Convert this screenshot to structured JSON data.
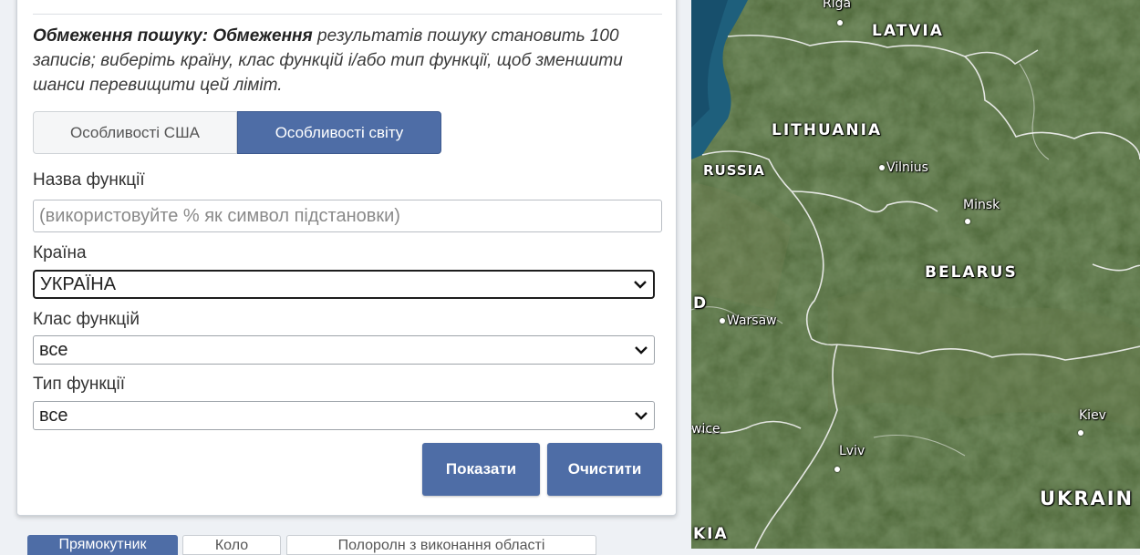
{
  "search": {
    "limit_bold": "Обмеження пошуку: Обмеження",
    "limit_text": " результатів пошуку становить 100 записів; виберіть країну, клас функцій і/або тип функції, щоб зменшити шанси перевищити цей ліміт.",
    "tabs": [
      {
        "label": "Особливості США",
        "active": false
      },
      {
        "label": "Особливості світу",
        "active": true
      }
    ],
    "feature_name_label": "Назва функції",
    "feature_name_placeholder": "(використовуйте % як символ підстановки)",
    "country_label": "Країна",
    "country_value": "УКРАЇНА",
    "feature_class_label": "Клас функцій",
    "feature_class_value": "все",
    "feature_type_label": "Тип функції",
    "feature_type_value": "все",
    "show_button": "Показати",
    "clear_button": "Очистити"
  },
  "bottom_tabs": [
    {
      "label": "Прямокутник",
      "active": true
    },
    {
      "label": "Коло",
      "active": false
    },
    {
      "label": "Полоролн з виконання області",
      "active": false
    }
  ],
  "map": {
    "countries": [
      "LATVIA",
      "LITHUANIA",
      "RUSSIA",
      "BELARUS",
      "UKRAIN",
      "KIA",
      "D"
    ],
    "cities": [
      "Riga",
      "Vilnius",
      "Minsk",
      "Warsaw",
      "Kiev",
      "Lviv",
      "wice"
    ]
  },
  "colors": {
    "accent": "#4e6da6",
    "map_green": "#3f5a2c",
    "sea": "#1d5a78"
  }
}
